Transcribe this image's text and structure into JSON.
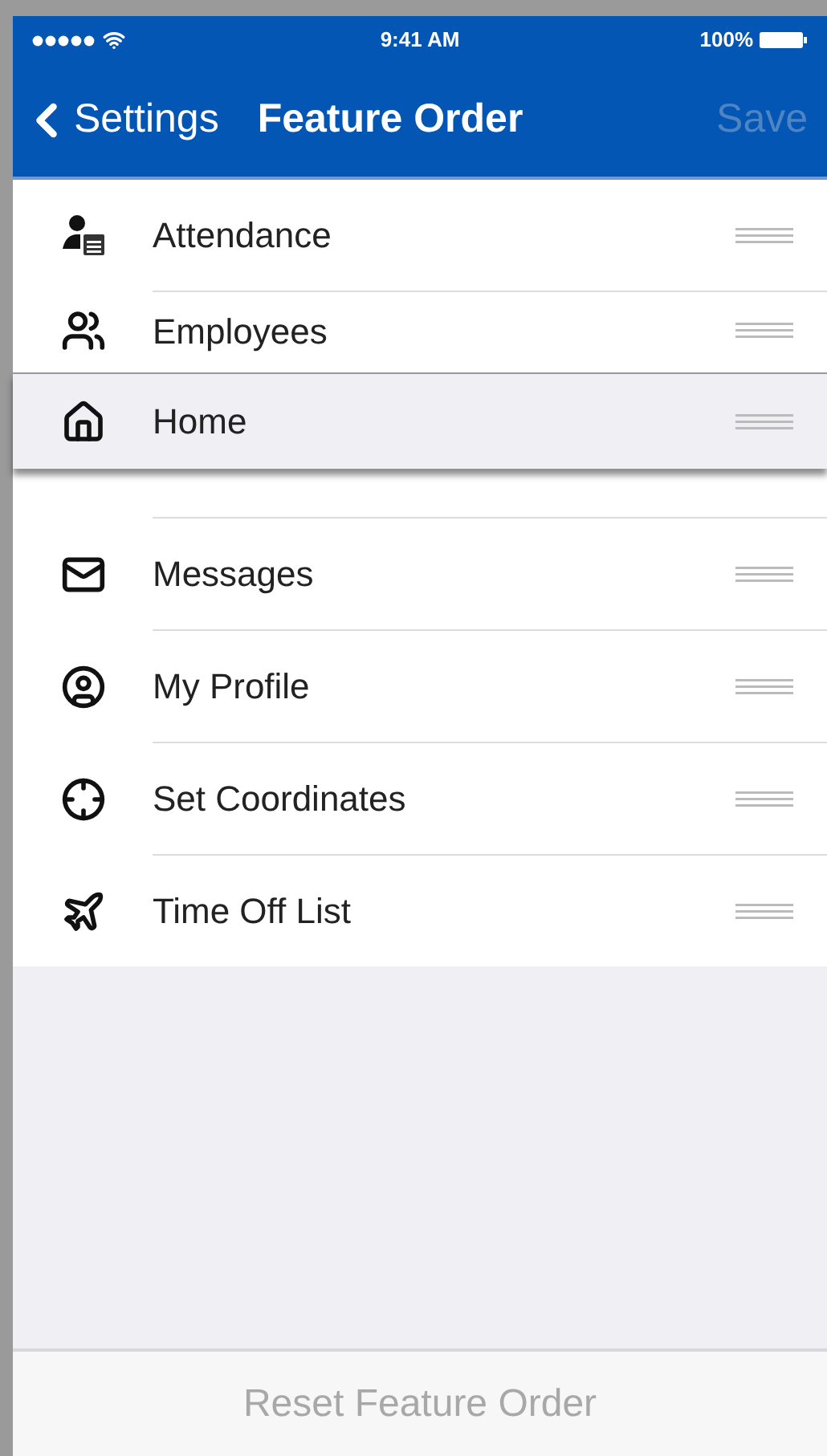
{
  "status_bar": {
    "time": "9:41 AM",
    "battery": "100%"
  },
  "nav_bar": {
    "back": "Settings",
    "title": "Feature Order",
    "save": {
      "label": "Save",
      "disabled": true
    }
  },
  "features": [
    {
      "label": "Attendance",
      "dragging": false
    },
    {
      "label": "Employees",
      "dragging": false
    },
    {
      "label": "Home",
      "dragging": true
    },
    {
      "label": "Messages",
      "dragging": false
    },
    {
      "label": "My Profile",
      "dragging": false
    },
    {
      "label": "Set Coordinates",
      "dragging": false
    },
    {
      "label": "Time Off List",
      "dragging": false
    }
  ],
  "footer": {
    "label": "Reset Feature Order",
    "disabled": true
  }
}
